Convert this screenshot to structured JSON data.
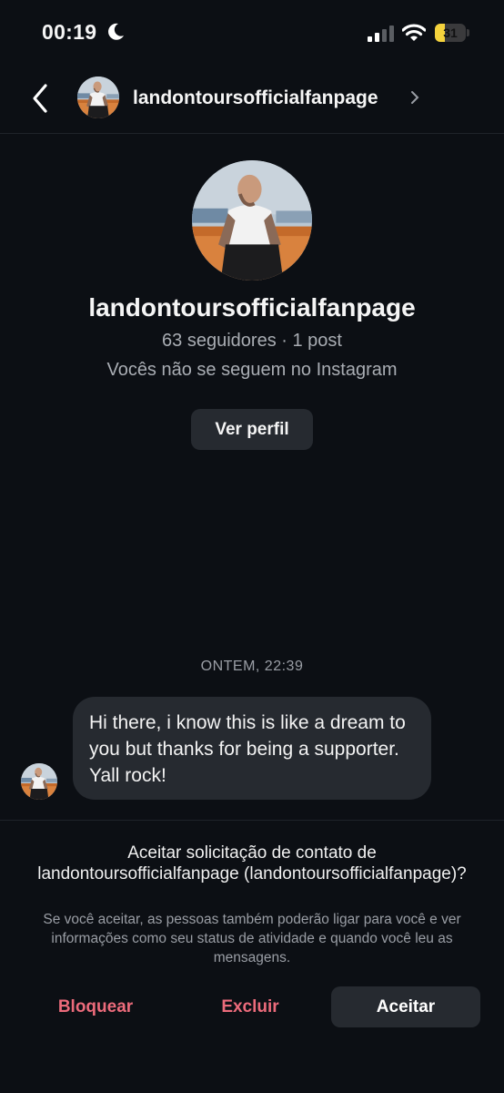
{
  "status_bar": {
    "time": "00:19",
    "battery_level": "31",
    "battery_fraction": 0.31,
    "battery_color": "#f4d23c"
  },
  "header": {
    "username": "landontoursofficialfanpage"
  },
  "profile": {
    "username": "landontoursofficialfanpage",
    "stats": "63 seguidores · 1 post",
    "follow_status": "Vocês não se seguem no Instagram",
    "view_profile_label": "Ver perfil"
  },
  "conversation": {
    "timestamp": "ONTEM, 22:39",
    "messages": [
      {
        "text": "Hi there, i know this is like a dream to you but thanks for being a supporter. Yall rock!"
      }
    ]
  },
  "request": {
    "title": "Aceitar solicitação de contato de landontoursofficialfanpage (landontoursofficialfanpage)?",
    "description": "Se você aceitar, as pessoas também poderão ligar para você e ver informações como seu status de atividade e quando você leu as mensagens.",
    "block_label": "Bloquear",
    "delete_label": "Excluir",
    "accept_label": "Aceitar"
  },
  "colors": {
    "background": "#0c0f14",
    "bubble": "#262a30",
    "danger": "#ec6b7b",
    "muted_text": "#9a9ea5"
  },
  "icons": [
    "moon-icon",
    "signal-icon",
    "wifi-icon",
    "battery-icon",
    "back-arrow-icon",
    "chevron-right-icon"
  ]
}
